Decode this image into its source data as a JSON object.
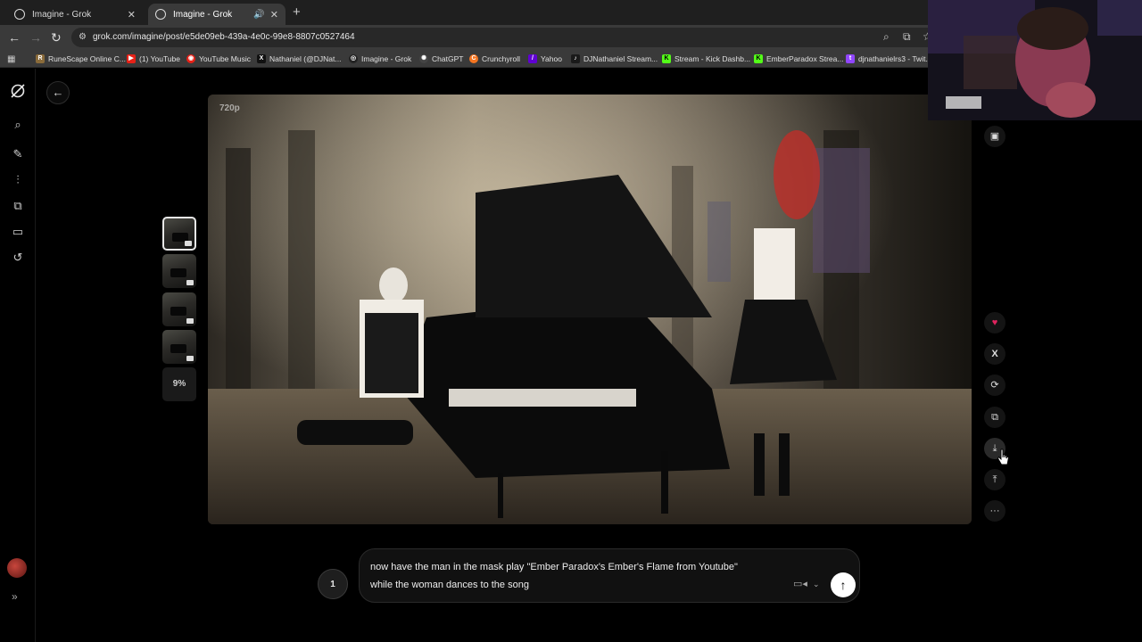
{
  "browser": {
    "tabs": [
      {
        "title": "Imagine - Grok",
        "active": false
      },
      {
        "title": "Imagine - Grok",
        "active": true
      }
    ],
    "url": "grok.com/imagine/post/e5de09eb-439a-4e0c-99e8-8807c0527464",
    "bookmarks": [
      {
        "label": "RuneScape Online C...",
        "icon": "runescape-icon",
        "color": "#8a6b3a",
        "glyph": "R"
      },
      {
        "label": "(1) YouTube",
        "icon": "youtube-icon",
        "color": "#e62117",
        "glyph": "▶"
      },
      {
        "label": "YouTube Music",
        "icon": "youtube-music-icon",
        "color": "#e62117",
        "glyph": "◉"
      },
      {
        "label": "Nathaniel (@DJNat...",
        "icon": "x-icon",
        "color": "#111111",
        "glyph": "X"
      },
      {
        "label": "Imagine - Grok",
        "icon": "grok-icon",
        "color": "#222222",
        "glyph": "◎"
      },
      {
        "label": "ChatGPT",
        "icon": "chatgpt-icon",
        "color": "#444444",
        "glyph": "✺"
      },
      {
        "label": "Crunchyroll",
        "icon": "crunchyroll-icon",
        "color": "#f47521",
        "glyph": "C"
      },
      {
        "label": "Yahoo",
        "icon": "yahoo-icon",
        "color": "#6001d2",
        "glyph": "/"
      },
      {
        "label": "DJNathaniel Stream...",
        "icon": "kick-icon",
        "color": "#1a1a1a",
        "glyph": "♪"
      },
      {
        "label": "Stream - Kick Dashb...",
        "icon": "kick-icon",
        "color": "#53fc18",
        "glyph": "K"
      },
      {
        "label": "EmberParadox Strea...",
        "icon": "kick-icon",
        "color": "#53fc18",
        "glyph": "K"
      },
      {
        "label": "djnathanielrs3 - Twit...",
        "icon": "twitch-icon",
        "color": "#9146ff",
        "glyph": "t"
      }
    ]
  },
  "viewer": {
    "resolution": "720p",
    "progress": "9%",
    "thumbnails_count": 4
  },
  "actions": [
    {
      "name": "like-button",
      "icon": "heart-icon",
      "glyph": "♥",
      "color": "#e0245e"
    },
    {
      "name": "share-x-button",
      "icon": "x-icon",
      "glyph": "𝕏",
      "color": "#dddddd"
    },
    {
      "name": "regenerate-button",
      "icon": "refresh-icon",
      "glyph": "⟳",
      "color": "#dddddd"
    },
    {
      "name": "edit-image-button",
      "icon": "image-edit-icon",
      "glyph": "⧉",
      "color": "#dddddd"
    },
    {
      "name": "download-button",
      "icon": "download-icon",
      "glyph": "⤓",
      "color": "#dddddd"
    },
    {
      "name": "share-button",
      "icon": "upload-icon",
      "glyph": "⤒",
      "color": "#dddddd"
    },
    {
      "name": "more-button",
      "icon": "ellipsis-icon",
      "glyph": "···",
      "color": "#dddddd"
    }
  ],
  "prompt": {
    "count": "1",
    "text": "now have the man in the mask play \"Ember Paradox's Ember's Flame from Youtube\" while the woman dances to the song"
  }
}
